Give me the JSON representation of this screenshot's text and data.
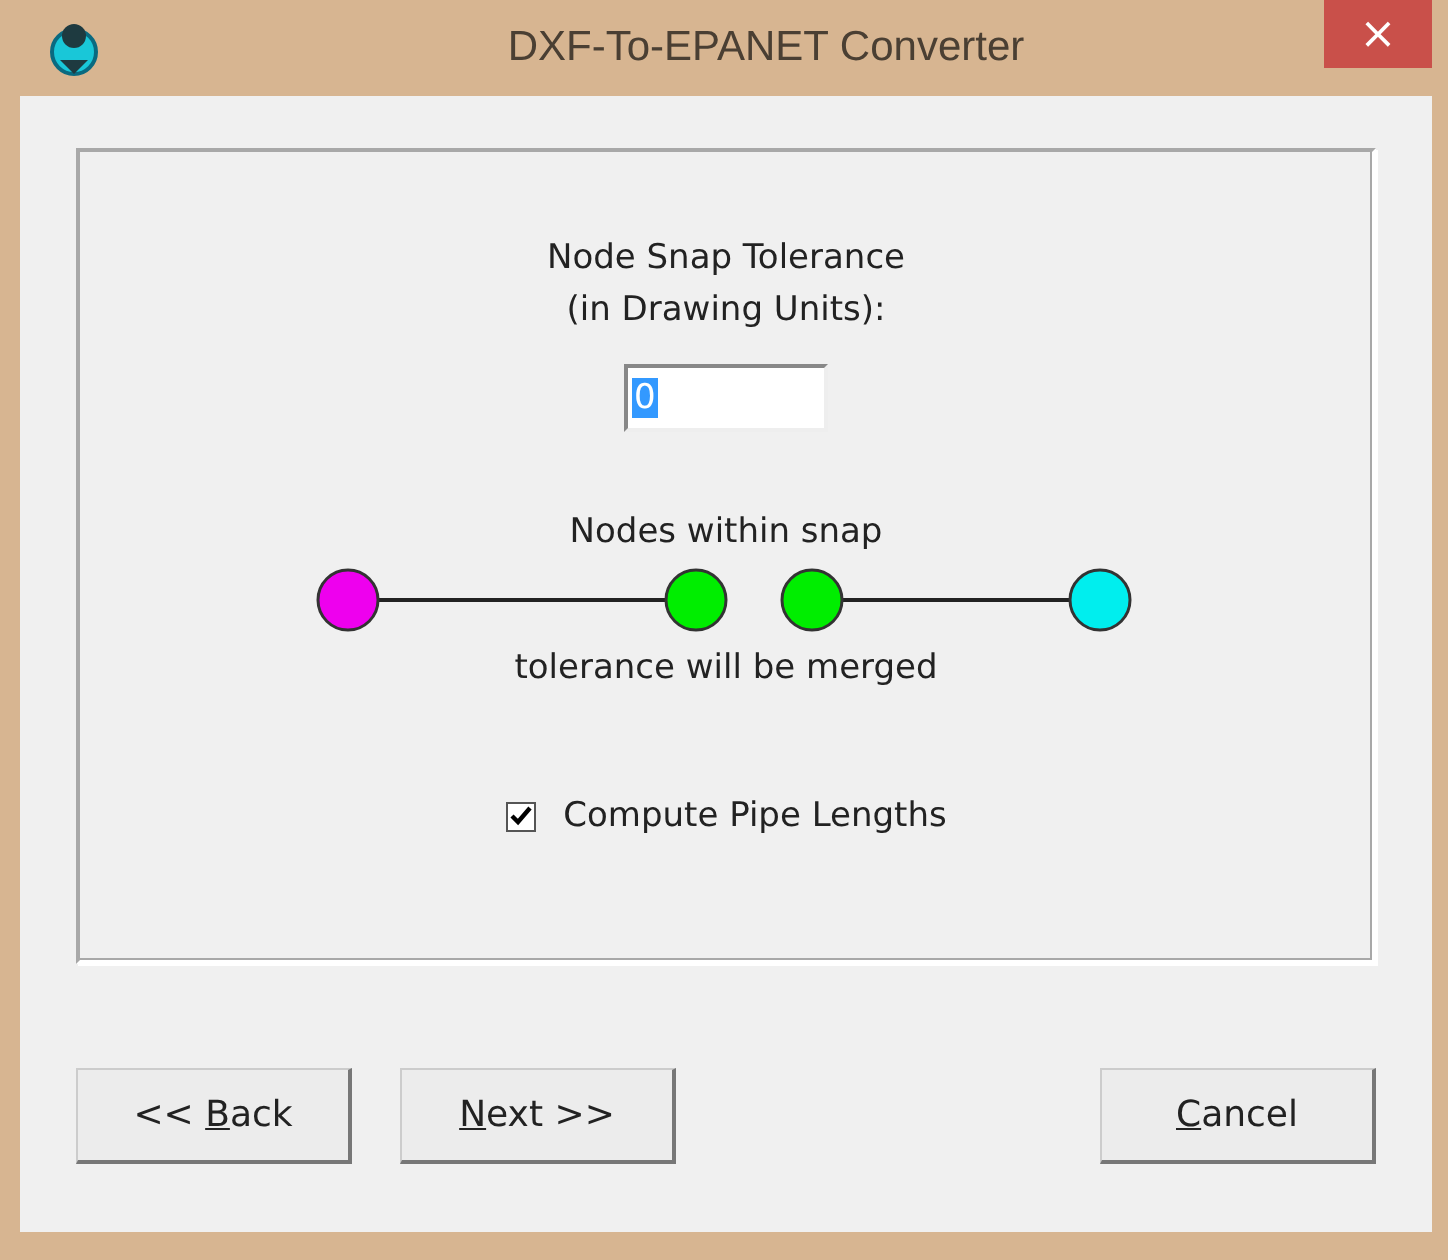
{
  "window": {
    "title": "DXF-To-EPANET Converter",
    "close": "×"
  },
  "panel": {
    "heading": "Node Snap Tolerance\n(in Drawing Units):",
    "tolerance_field": {
      "value": "0",
      "selected_text": true
    },
    "diagram": {
      "caption_top": "Nodes within snap",
      "caption_bottom": "tolerance will be merged",
      "nodes": [
        {
          "color": "#ee00ee"
        },
        {
          "color": "#00ee00"
        },
        {
          "color": "#00ee00"
        },
        {
          "color": "#00eeee"
        }
      ]
    },
    "checkbox": {
      "label": "Compute Pipe Lengths",
      "checked": true
    }
  },
  "buttons": [
    {
      "before": "<< ",
      "key": "B",
      "after": "ack",
      "kind": "navigation"
    },
    {
      "key": "N",
      "after": "ext >>",
      "kind": "navigation"
    },
    {
      "key": "C",
      "after": "ancel",
      "kind": "cancel"
    }
  ]
}
